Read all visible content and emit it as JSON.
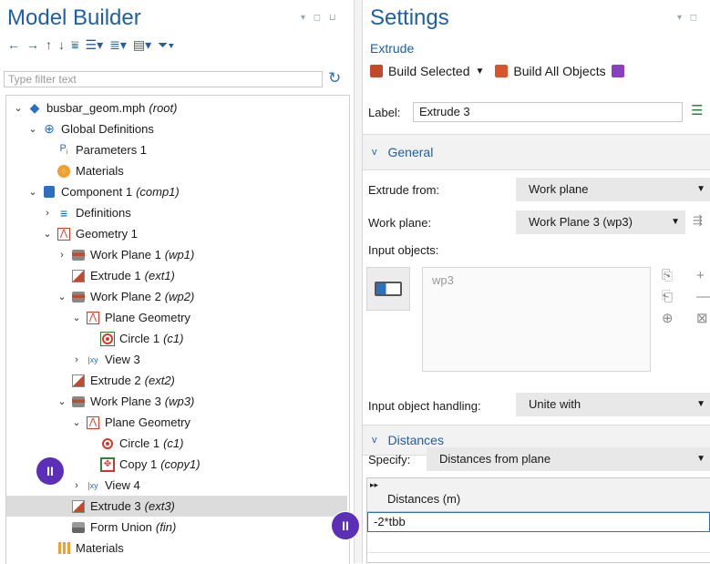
{
  "left": {
    "title": "Model Builder",
    "filter_placeholder": "Type filter text",
    "tree": [
      {
        "indent": 0,
        "toggle": "v",
        "icon": "root-icon",
        "label": "busbar_geom.mph",
        "tag": "(root)",
        "name": "tree-item-root"
      },
      {
        "indent": 1,
        "toggle": "v",
        "icon": "globe-icon",
        "label": "Global Definitions",
        "tag": "",
        "name": "tree-item-global-definitions"
      },
      {
        "indent": 2,
        "toggle": "",
        "icon": "parameters-icon",
        "label": "Parameters 1",
        "tag": "",
        "name": "tree-item-parameters-1"
      },
      {
        "indent": 2,
        "toggle": "",
        "icon": "materials-icon",
        "label": "Materials",
        "tag": "",
        "name": "tree-item-global-materials"
      },
      {
        "indent": 1,
        "toggle": "v",
        "icon": "component-icon",
        "label": "Component 1",
        "tag": "(comp1)",
        "name": "tree-item-component-1"
      },
      {
        "indent": 2,
        "toggle": ">",
        "icon": "definitions-icon",
        "label": "Definitions",
        "tag": "",
        "name": "tree-item-definitions"
      },
      {
        "indent": 2,
        "toggle": "v",
        "icon": "geometry-icon",
        "label": "Geometry 1",
        "tag": "",
        "name": "tree-item-geometry-1"
      },
      {
        "indent": 3,
        "toggle": ">",
        "icon": "workplane-icon",
        "label": "Work Plane 1",
        "tag": "(wp1)",
        "name": "tree-item-work-plane-1"
      },
      {
        "indent": 3,
        "toggle": "",
        "icon": "extrude-icon",
        "label": "Extrude 1",
        "tag": "(ext1)",
        "name": "tree-item-extrude-1"
      },
      {
        "indent": 3,
        "toggle": "v",
        "icon": "workplane-icon",
        "label": "Work Plane 2",
        "tag": "(wp2)",
        "name": "tree-item-work-plane-2"
      },
      {
        "indent": 4,
        "toggle": "v",
        "icon": "geometry-icon",
        "label": "Plane Geometry",
        "tag": "",
        "name": "tree-item-plane-geometry-2"
      },
      {
        "indent": 5,
        "toggle": "",
        "icon": "circle-icon",
        "label": "Circle 1",
        "tag": "(c1)",
        "name": "tree-item-circle-1-wp2",
        "boxed": true
      },
      {
        "indent": 4,
        "toggle": ">",
        "icon": "view-icon",
        "label": "View 3",
        "tag": "",
        "name": "tree-item-view-3"
      },
      {
        "indent": 3,
        "toggle": "",
        "icon": "extrude-icon",
        "label": "Extrude 2",
        "tag": "(ext2)",
        "name": "tree-item-extrude-2"
      },
      {
        "indent": 3,
        "toggle": "v",
        "icon": "workplane-icon",
        "label": "Work Plane 3",
        "tag": "(wp3)",
        "name": "tree-item-work-plane-3"
      },
      {
        "indent": 4,
        "toggle": "v",
        "icon": "geometry-icon",
        "label": "Plane Geometry",
        "tag": "",
        "name": "tree-item-plane-geometry-3"
      },
      {
        "indent": 5,
        "toggle": "",
        "icon": "circle-icon",
        "label": "Circle 1",
        "tag": "(c1)",
        "name": "tree-item-circle-1-wp3"
      },
      {
        "indent": 5,
        "toggle": "",
        "icon": "copy-icon",
        "label": "Copy 1",
        "tag": "(copy1)",
        "name": "tree-item-copy-1",
        "boxed": true
      },
      {
        "indent": 4,
        "toggle": ">",
        "icon": "view-icon",
        "label": "View 4",
        "tag": "",
        "name": "tree-item-view-4"
      },
      {
        "indent": 3,
        "toggle": "",
        "icon": "extrude-icon",
        "label": "Extrude 3",
        "tag": "(ext3)",
        "name": "tree-item-extrude-3",
        "selected": true
      },
      {
        "indent": 3,
        "toggle": "",
        "icon": "formunion-icon",
        "label": "Form Union",
        "tag": "(fin)",
        "name": "tree-item-form-union"
      },
      {
        "indent": 2,
        "toggle": "",
        "icon": "materials-grid-icon",
        "label": "Materials",
        "tag": "",
        "name": "tree-item-materials"
      }
    ]
  },
  "right": {
    "title": "Settings",
    "subtitle": "Extrude",
    "build_selected": "Build Selected",
    "build_all": "Build All Objects",
    "label_caption": "Label:",
    "label_value": "Extrude 3",
    "general_section": "General",
    "extrude_from_caption": "Extrude from:",
    "extrude_from_value": "Work plane",
    "work_plane_caption": "Work plane:",
    "work_plane_value": "Work Plane 3 (wp3)",
    "input_objects_caption": "Input objects:",
    "input_objects_item": "wp3",
    "input_handling_caption": "Input object handling:",
    "input_handling_value": "Unite with",
    "distances_section": "Distances",
    "specify_caption": "Specify:",
    "specify_value": "Distances from plane",
    "table_header": "Distances (m)",
    "table_row_1": "-2*tbb"
  },
  "badges": [
    "II",
    "II"
  ],
  "colors": {
    "accent": "#1d5fa8",
    "badge": "#5b2fb8",
    "selected": "#dcdcdc"
  }
}
